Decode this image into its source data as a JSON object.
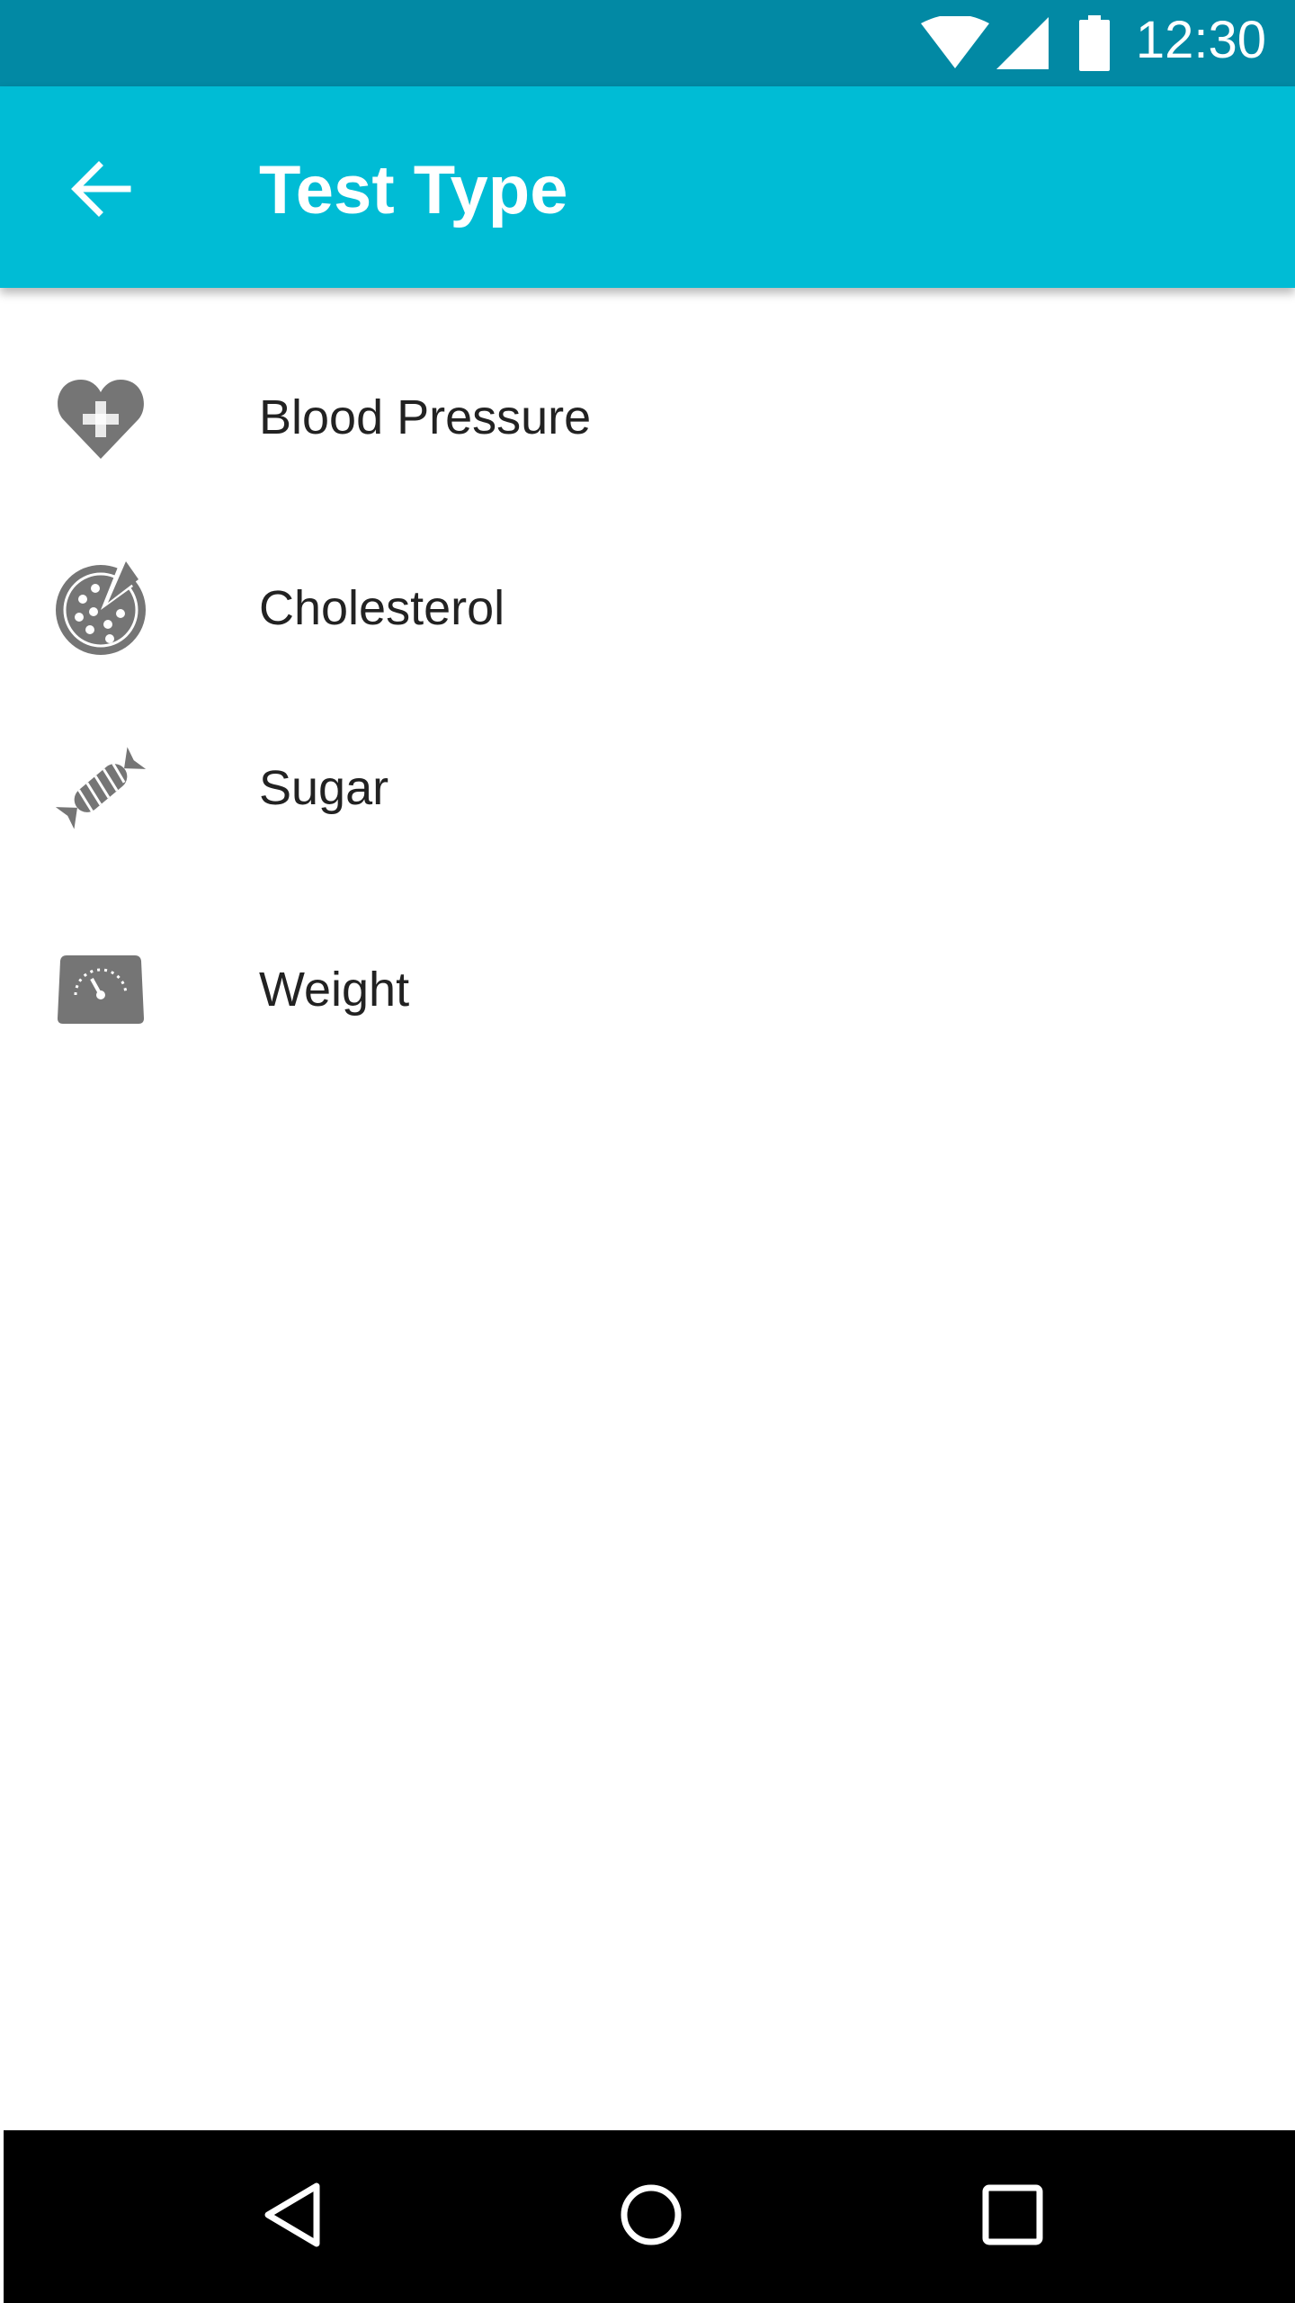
{
  "status_bar": {
    "time": "12:30",
    "icons": [
      "wifi-icon",
      "cellular-signal-icon",
      "battery-icon"
    ]
  },
  "app_bar": {
    "title": "Test Type",
    "back_icon": "arrow-back-icon"
  },
  "test_types": [
    {
      "label": "Blood Pressure",
      "icon": "heart-plus-icon"
    },
    {
      "label": "Cholesterol",
      "icon": "pizza-icon"
    },
    {
      "label": "Sugar",
      "icon": "candy-icon"
    },
    {
      "label": "Weight",
      "icon": "scale-icon"
    }
  ],
  "nav_bar": {
    "icons": [
      "nav-back-icon",
      "nav-home-icon",
      "nav-recents-icon"
    ]
  },
  "colors": {
    "status_bar": "#0289a4",
    "app_bar": "#00bcd5",
    "icon_gray": "#757575",
    "text": "#222222"
  }
}
